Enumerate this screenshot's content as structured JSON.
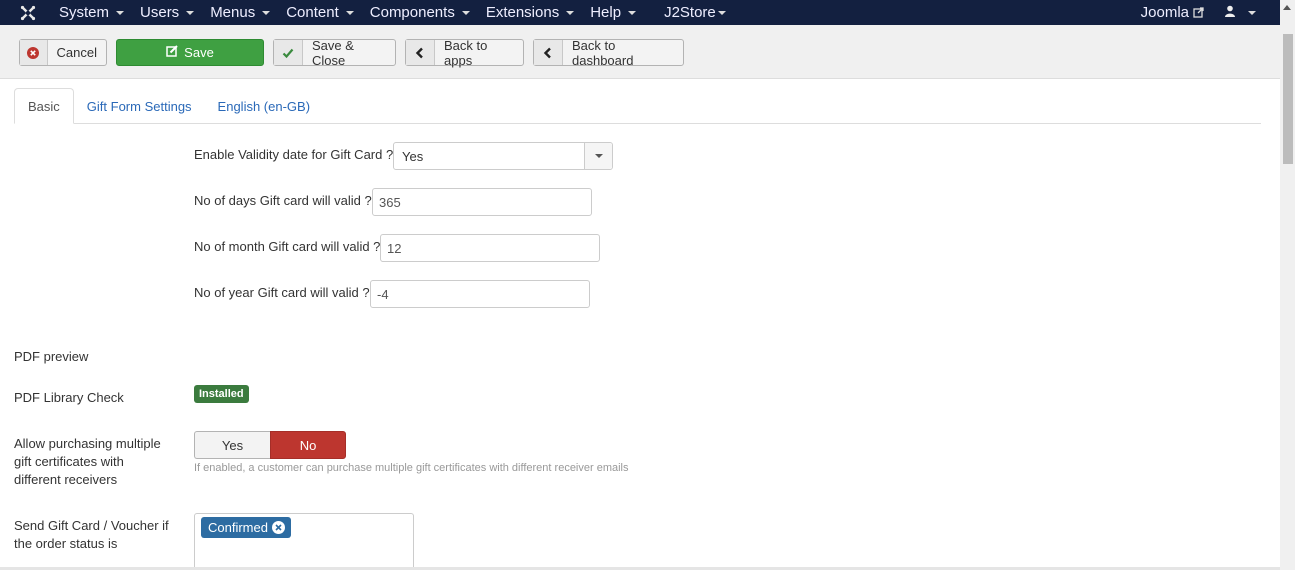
{
  "navbar": {
    "logo_icon": "joomla-logo-icon",
    "menus": [
      {
        "label": "System"
      },
      {
        "label": "Users"
      },
      {
        "label": "Menus"
      },
      {
        "label": "Content"
      },
      {
        "label": "Components"
      },
      {
        "label": "Extensions"
      },
      {
        "label": "Help"
      }
    ],
    "j2store_label": "J2Store",
    "site_link_label": "Joomla",
    "site_link_icon": "external-link-icon",
    "user_icon": "user-icon"
  },
  "toolbar": {
    "cancel_label": "Cancel",
    "save_label": "Save",
    "save_close_label": "Save & Close",
    "back_apps_label": "Back to apps",
    "back_dashboard_label": "Back to dashboard"
  },
  "tabs": [
    {
      "label": "Basic",
      "active": true
    },
    {
      "label": "Gift Form Settings",
      "active": false
    },
    {
      "label": "English (en-GB)",
      "active": false
    }
  ],
  "form": {
    "validity": {
      "label": "Enable Validity date for Gift Card ?",
      "value": "Yes"
    },
    "days": {
      "label": "No of days Gift card will valid ?",
      "value": "365"
    },
    "months": {
      "label": "No of month Gift card will valid ?",
      "value": "12"
    },
    "years": {
      "label": "No of year Gift card will valid ?",
      "value": "-4"
    },
    "pdf_preview": {
      "label": "PDF preview"
    },
    "pdf_library": {
      "label": "PDF Library Check",
      "status": "Installed",
      "status_color": "#3b7b3e"
    },
    "multiple_receivers": {
      "label_lines": [
        "Allow purchasing multiple",
        "gift certificates with",
        "different receivers"
      ],
      "options": [
        "Yes",
        "No"
      ],
      "selected": "No",
      "help": "If enabled, a customer can purchase multiple gift certificates with different receiver emails"
    },
    "order_status": {
      "label_lines": [
        "Send Gift Card / Voucher if",
        "the order status is"
      ],
      "selected_chips": [
        "Confirmed"
      ]
    }
  },
  "colors": {
    "navbar_bg": "#132040",
    "save_green": "#3fa042",
    "toggle_no_red": "#bd362f",
    "chip_blue": "#2d6ca2",
    "link_blue": "#2a69b8"
  }
}
